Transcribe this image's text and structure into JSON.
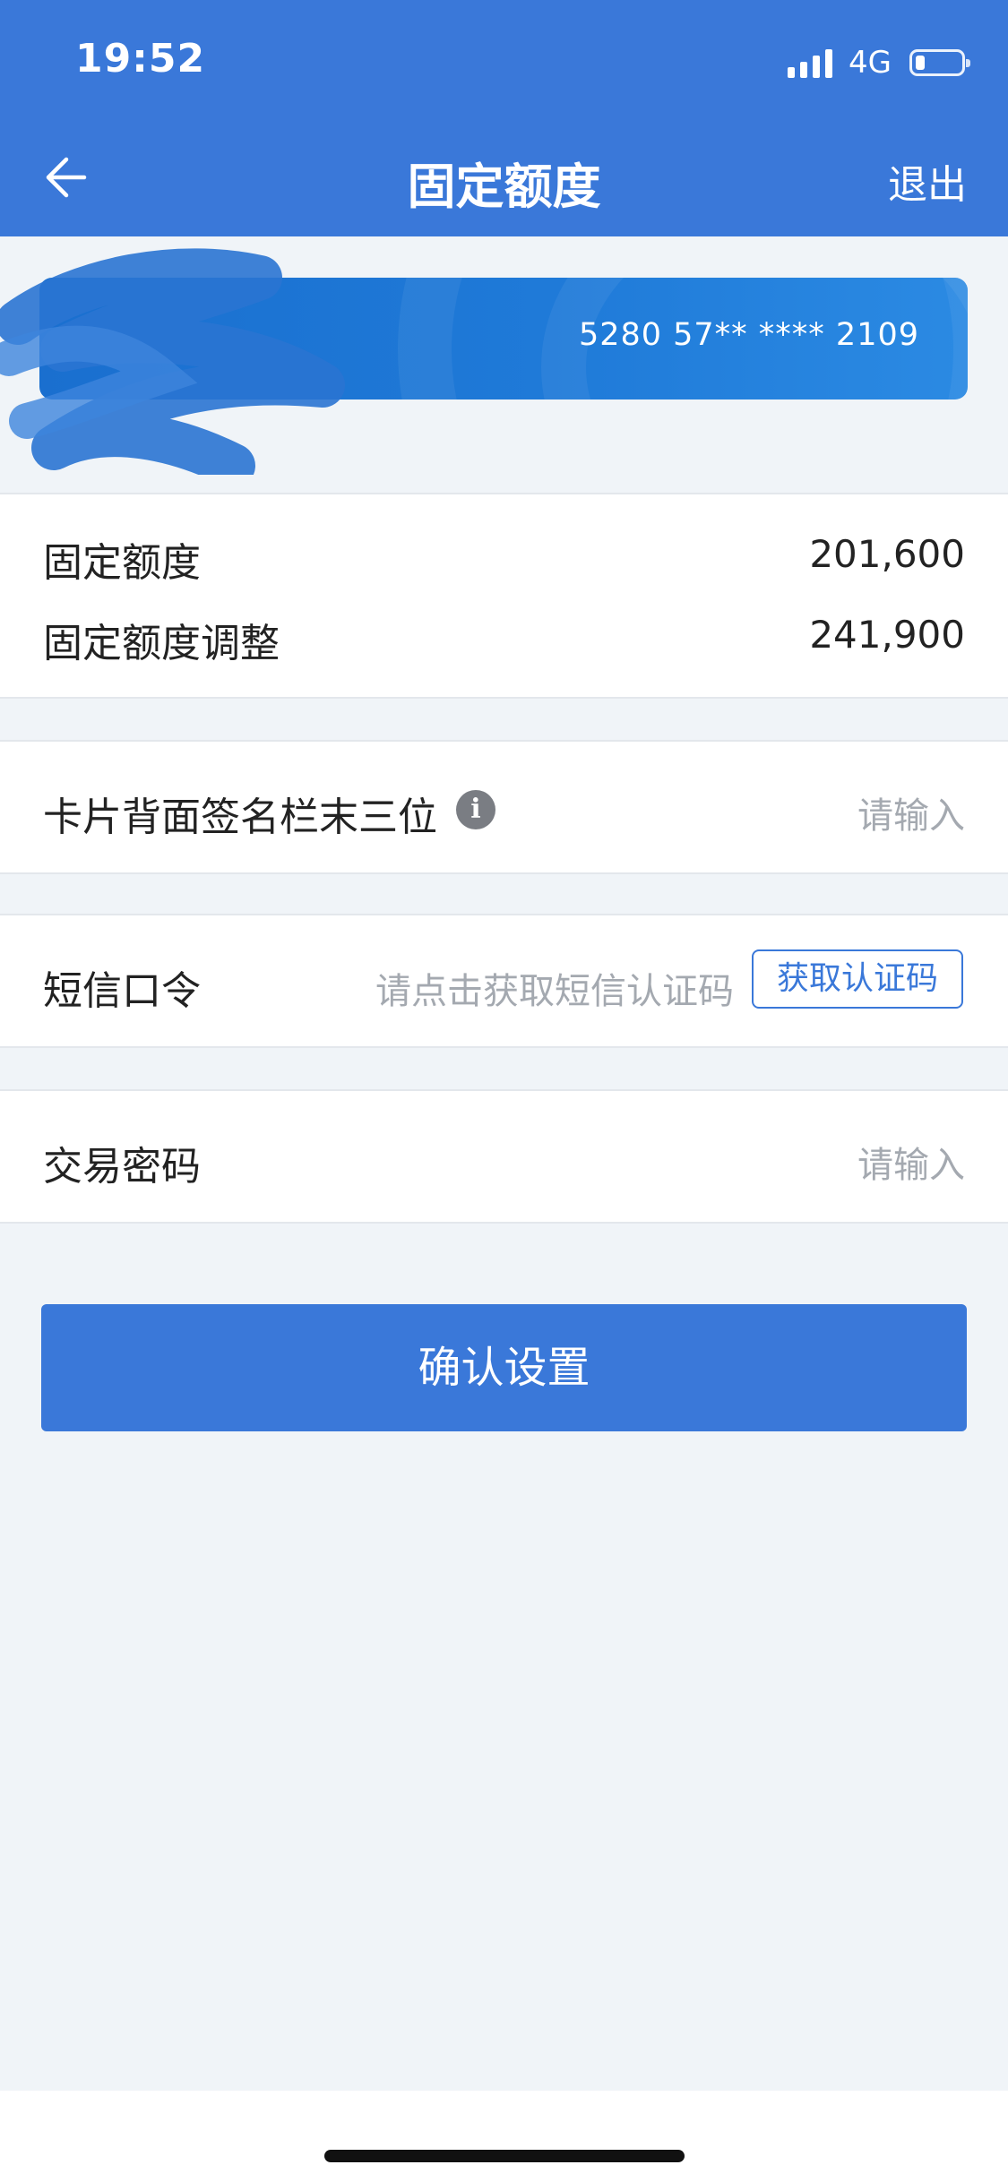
{
  "status_bar": {
    "time": "19:52",
    "network": "4G",
    "battery_level": 0.2
  },
  "nav": {
    "title": "固定额度",
    "exit_label": "退出",
    "back_icon": "arrow-left-icon"
  },
  "card": {
    "number": "5280 57** **** 2109"
  },
  "limits": {
    "rows": [
      {
        "label": "固定额度",
        "value": "201,600"
      },
      {
        "label": "固定额度调整",
        "value": "241,900"
      }
    ]
  },
  "form": {
    "cvv": {
      "label": "卡片背面签名栏末三位",
      "placeholder": "请输入",
      "info_icon": "info-icon"
    },
    "sms": {
      "label": "短信口令",
      "placeholder": "请点击获取短信认证码",
      "button": "获取认证码"
    },
    "password": {
      "label": "交易密码",
      "placeholder": "请输入"
    }
  },
  "confirm_label": "确认设置",
  "colors": {
    "brand": "#3a78d9",
    "background": "#f0f4f8",
    "placeholder": "#a4a9b0"
  }
}
